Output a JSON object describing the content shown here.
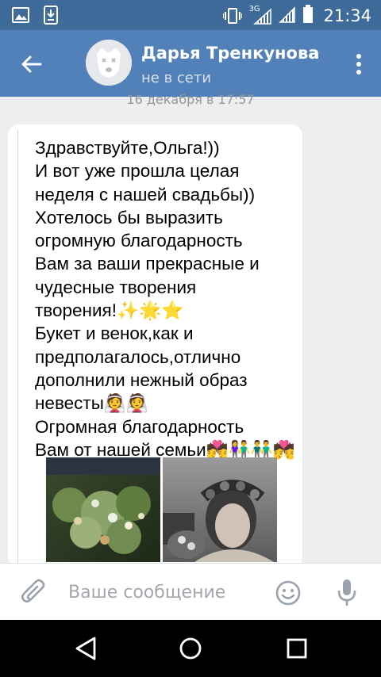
{
  "status_bar": {
    "network_type": "3G",
    "time": "21:34",
    "icons": [
      "gallery-icon",
      "download-icon",
      "vibrate-icon",
      "signal-icon",
      "signal-icon",
      "battery-icon"
    ]
  },
  "header": {
    "contact_name": "Дарья Тренкунова",
    "status": "не в сети",
    "back_icon": "arrow-left-icon",
    "menu_icon": "more-vertical-icon"
  },
  "chat": {
    "date_separator": "16 декабря в 17:57",
    "message": {
      "text": "Здравствуйте,Ольга!))\nИ вот уже прошла целая\nнеделя с нашей свадьбы))\nХотелось бы выразить\nогромную благодарность\nВам за ваши прекрасные и\nчудесные творения\nтворения!✨🌟⭐\nБукет и венок,как и\nпредполагалось,отлично\nдополнили нежный образ\nневесты👰👰\nОгромная благодарность\nВам от нашей семьи💏👫👬💏",
      "photos": [
        {
          "name": "bouquet-photo",
          "alt_icon": "photo"
        },
        {
          "name": "bride-wreath-photo",
          "alt_icon": "photo"
        }
      ]
    }
  },
  "input": {
    "placeholder": "Ваше сообщение",
    "value": "",
    "attach_icon": "paperclip-icon",
    "emoji_icon": "smiley-icon",
    "mic_icon": "microphone-icon"
  },
  "nav_bar": {
    "icons": [
      "triangle-back-icon",
      "circle-home-icon",
      "square-recents-icon"
    ]
  },
  "colors": {
    "status_bar": "#3f6b9a",
    "header": "#5181b8",
    "chat_bg": "#edeef0",
    "bubble": "#ffffff",
    "nav_bar": "#000000"
  }
}
